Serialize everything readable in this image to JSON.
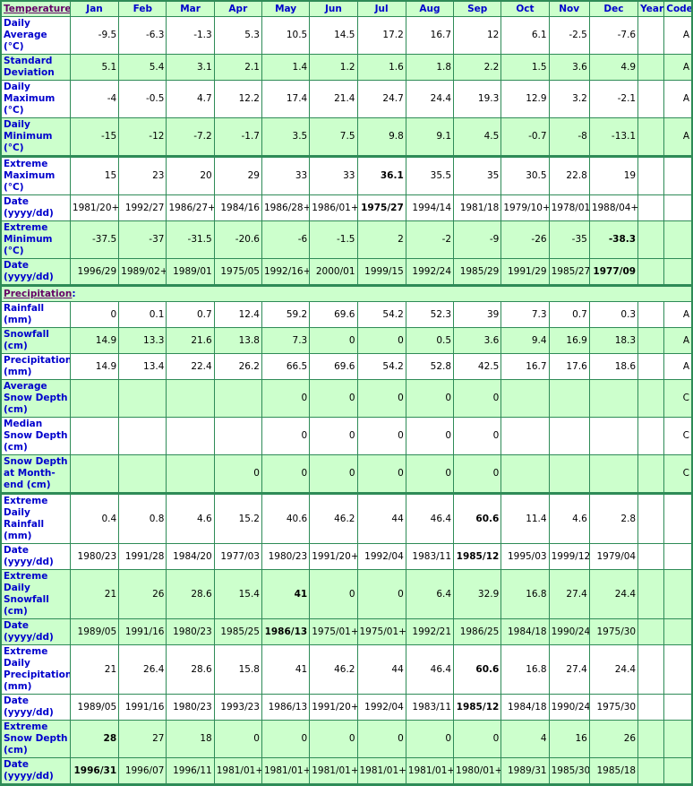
{
  "header": {
    "section_temperature": "Temperature",
    "colon": ":",
    "months": [
      "Jan",
      "Feb",
      "Mar",
      "Apr",
      "May",
      "Jun",
      "Jul",
      "Aug",
      "Sep",
      "Oct",
      "Nov",
      "Dec"
    ],
    "year": "Year",
    "code": "Code"
  },
  "temperature": [
    {
      "label": "Daily Average (°C)",
      "values": [
        "-9.5",
        "-6.3",
        "-1.3",
        "5.3",
        "10.5",
        "14.5",
        "17.2",
        "16.7",
        "12",
        "6.1",
        "-2.5",
        "-7.6"
      ],
      "year": "",
      "code": "A"
    },
    {
      "label": "Standard Deviation",
      "values": [
        "5.1",
        "5.4",
        "3.1",
        "2.1",
        "1.4",
        "1.2",
        "1.6",
        "1.8",
        "2.2",
        "1.5",
        "3.6",
        "4.9"
      ],
      "year": "",
      "code": "A"
    },
    {
      "label": "Daily Maximum (°C)",
      "values": [
        "-4",
        "-0.5",
        "4.7",
        "12.2",
        "17.4",
        "21.4",
        "24.7",
        "24.4",
        "19.3",
        "12.9",
        "3.2",
        "-2.1"
      ],
      "year": "",
      "code": "A"
    },
    {
      "label": "Daily Minimum (°C)",
      "values": [
        "-15",
        "-12",
        "-7.2",
        "-1.7",
        "3.5",
        "7.5",
        "9.8",
        "9.1",
        "4.5",
        "-0.7",
        "-8",
        "-13.1"
      ],
      "year": "",
      "code": "A"
    },
    {
      "label": "Extreme Maximum (°C)",
      "values": [
        "15",
        "23",
        "20",
        "29",
        "33",
        "33",
        "36.1",
        "35.5",
        "35",
        "30.5",
        "22.8",
        "19"
      ],
      "year": "",
      "code": "",
      "bold_index": 6
    },
    {
      "label": "Date (yyyy/dd)",
      "values": [
        "1981/20+",
        "1992/27",
        "1986/27+",
        "1984/16",
        "1986/28+",
        "1986/01+",
        "1975/27",
        "1994/14",
        "1981/18",
        "1979/10+",
        "1978/01",
        "1988/04+"
      ],
      "year": "",
      "code": "",
      "bold_index": 6
    },
    {
      "label": "Extreme Minimum (°C)",
      "values": [
        "-37.5",
        "-37",
        "-31.5",
        "-20.6",
        "-6",
        "-1.5",
        "2",
        "-2",
        "-9",
        "-26",
        "-35",
        "-38.3"
      ],
      "year": "",
      "code": "",
      "bold_index": 11
    },
    {
      "label": "Date (yyyy/dd)",
      "values": [
        "1996/29",
        "1989/02+",
        "1989/01",
        "1975/05",
        "1992/16+",
        "2000/01",
        "1999/15",
        "1992/24",
        "1985/29",
        "1991/29",
        "1985/27",
        "1977/09"
      ],
      "year": "",
      "code": "",
      "bold_index": 11
    }
  ],
  "section_precipitation": "Precipitation",
  "precipitation": [
    {
      "label": "Rainfall (mm)",
      "values": [
        "0",
        "0.1",
        "0.7",
        "12.4",
        "59.2",
        "69.6",
        "54.2",
        "52.3",
        "39",
        "7.3",
        "0.7",
        "0.3"
      ],
      "year": "",
      "code": "A"
    },
    {
      "label": "Snowfall (cm)",
      "values": [
        "14.9",
        "13.3",
        "21.6",
        "13.8",
        "7.3",
        "0",
        "0",
        "0.5",
        "3.6",
        "9.4",
        "16.9",
        "18.3"
      ],
      "year": "",
      "code": "A"
    },
    {
      "label": "Precipitation (mm)",
      "values": [
        "14.9",
        "13.4",
        "22.4",
        "26.2",
        "66.5",
        "69.6",
        "54.2",
        "52.8",
        "42.5",
        "16.7",
        "17.6",
        "18.6"
      ],
      "year": "",
      "code": "A"
    },
    {
      "label": "Average Snow Depth (cm)",
      "values": [
        "",
        "",
        "",
        "",
        "0",
        "0",
        "0",
        "0",
        "0",
        "",
        "",
        ""
      ],
      "year": "",
      "code": "C"
    },
    {
      "label": "Median Snow Depth (cm)",
      "values": [
        "",
        "",
        "",
        "",
        "0",
        "0",
        "0",
        "0",
        "0",
        "",
        "",
        ""
      ],
      "year": "",
      "code": "C"
    },
    {
      "label": "Snow Depth at Month-end (cm)",
      "values": [
        "",
        "",
        "",
        "0",
        "0",
        "0",
        "0",
        "0",
        "0",
        "",
        "",
        ""
      ],
      "year": "",
      "code": "C"
    },
    {
      "label": "Extreme Daily Rainfall (mm)",
      "values": [
        "0.4",
        "0.8",
        "4.6",
        "15.2",
        "40.6",
        "46.2",
        "44",
        "46.4",
        "60.6",
        "11.4",
        "4.6",
        "2.8"
      ],
      "year": "",
      "code": "",
      "bold_index": 8
    },
    {
      "label": "Date (yyyy/dd)",
      "values": [
        "1980/23",
        "1991/28",
        "1984/20",
        "1977/03",
        "1980/23",
        "1991/20+",
        "1992/04",
        "1983/11",
        "1985/12",
        "1995/03",
        "1999/12",
        "1979/04"
      ],
      "year": "",
      "code": "",
      "bold_index": 8
    },
    {
      "label": "Extreme Daily Snowfall (cm)",
      "values": [
        "21",
        "26",
        "28.6",
        "15.4",
        "41",
        "0",
        "0",
        "6.4",
        "32.9",
        "16.8",
        "27.4",
        "24.4"
      ],
      "year": "",
      "code": "",
      "bold_index": 4
    },
    {
      "label": "Date (yyyy/dd)",
      "values": [
        "1989/05",
        "1991/16",
        "1980/23",
        "1985/25",
        "1986/13",
        "1975/01+",
        "1975/01+",
        "1992/21",
        "1986/25",
        "1984/18",
        "1990/24",
        "1975/30"
      ],
      "year": "",
      "code": "",
      "bold_index": 4
    },
    {
      "label": "Extreme Daily Precipitation (mm)",
      "values": [
        "21",
        "26.4",
        "28.6",
        "15.8",
        "41",
        "46.2",
        "44",
        "46.4",
        "60.6",
        "16.8",
        "27.4",
        "24.4"
      ],
      "year": "",
      "code": "",
      "bold_index": 8
    },
    {
      "label": "Date (yyyy/dd)",
      "values": [
        "1989/05",
        "1991/16",
        "1980/23",
        "1993/23",
        "1986/13",
        "1991/20+",
        "1992/04",
        "1983/11",
        "1985/12",
        "1984/18",
        "1990/24",
        "1975/30"
      ],
      "year": "",
      "code": "",
      "bold_index": 8
    },
    {
      "label": "Extreme Snow Depth (cm)",
      "values": [
        "28",
        "27",
        "18",
        "0",
        "0",
        "0",
        "0",
        "0",
        "0",
        "4",
        "16",
        "26"
      ],
      "year": "",
      "code": "",
      "bold_index": 0
    },
    {
      "label": "Date (yyyy/dd)",
      "values": [
        "1996/31",
        "1996/07",
        "1996/11",
        "1981/01+",
        "1981/01+",
        "1981/01+",
        "1981/01+",
        "1981/01+",
        "1980/01+",
        "1989/31",
        "1985/30",
        "1985/18"
      ],
      "year": "",
      "code": "",
      "bold_index": 0
    }
  ]
}
